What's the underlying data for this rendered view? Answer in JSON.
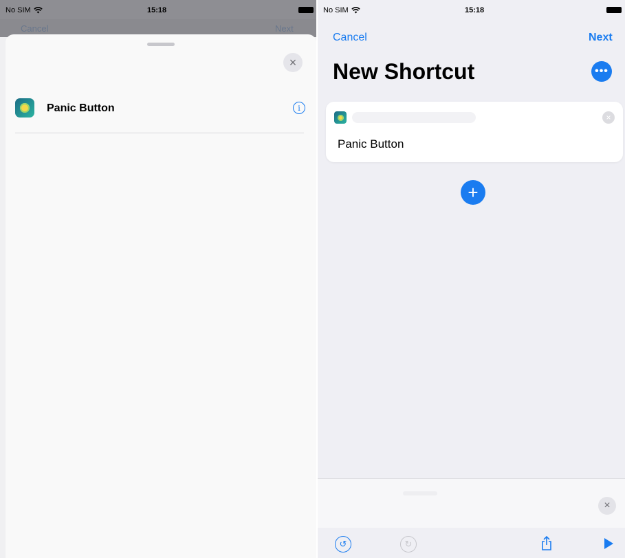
{
  "left_screen": {
    "status": {
      "carrier": "No SIM",
      "time": "15:18"
    },
    "background_nav": {
      "left_label": "Cancel",
      "right_label": "Next"
    },
    "sheet": {
      "close_icon": "close-icon",
      "items": [
        {
          "label": "Panic Button",
          "icon": "panic-button-app-icon",
          "accessory": "info-icon"
        }
      ]
    }
  },
  "right_screen": {
    "status": {
      "carrier": "No SIM",
      "time": "15:18"
    },
    "nav": {
      "cancel": "Cancel",
      "next": "Next"
    },
    "title": "New Shortcut",
    "more_button": "•••",
    "action_card": {
      "label": "Panic Button",
      "icon": "panic-button-app-icon"
    },
    "add_button": "+",
    "toolbar": [
      "undo-icon",
      "redo-icon",
      "share-icon",
      "play-icon"
    ]
  },
  "colors": {
    "accent": "#1a7cf0",
    "background": "#efeff4",
    "card": "#ffffff"
  }
}
